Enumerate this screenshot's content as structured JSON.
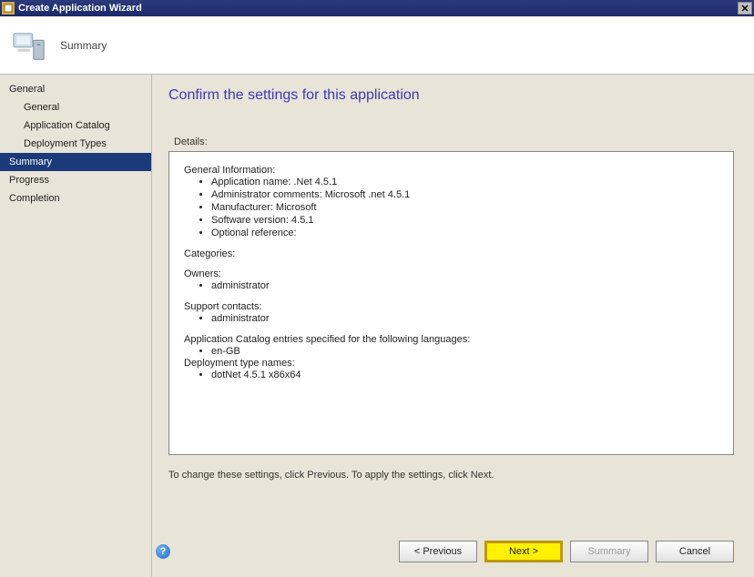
{
  "titlebar": {
    "title": "Create Application Wizard"
  },
  "header": {
    "title": "Summary"
  },
  "sidebar": {
    "items": [
      {
        "label": "General",
        "indent": false
      },
      {
        "label": "General",
        "indent": true
      },
      {
        "label": "Application Catalog",
        "indent": true
      },
      {
        "label": "Deployment Types",
        "indent": true
      },
      {
        "label": "Summary",
        "indent": false,
        "selected": true
      },
      {
        "label": "Progress",
        "indent": false
      },
      {
        "label": "Completion",
        "indent": false
      }
    ]
  },
  "content": {
    "page_title": "Confirm the settings for this application",
    "details_label": "Details:",
    "details": {
      "general_info_head": "General Information:",
      "general_info": [
        "Application name: .Net 4.5.1",
        "Administrator comments: Microsoft .net 4.5.1",
        "Manufacturer: Microsoft",
        "Software version: 4.5.1",
        "Optional reference:"
      ],
      "categories_head": "Categories:",
      "owners_head": "Owners:",
      "owners": [
        "administrator"
      ],
      "support_head": "Support contacts:",
      "support": [
        "administrator"
      ],
      "catalog_head": "Application Catalog entries specified for the following languages:",
      "catalog": [
        "en-GB"
      ],
      "deploy_head": "Deployment type names:",
      "deploy": [
        "dotNet 4.5.1 x86x64"
      ]
    },
    "hint": "To change these settings, click Previous. To apply the settings, click Next."
  },
  "buttons": {
    "previous": "< Previous",
    "next": "Next >",
    "summary": "Summary",
    "cancel": "Cancel"
  }
}
